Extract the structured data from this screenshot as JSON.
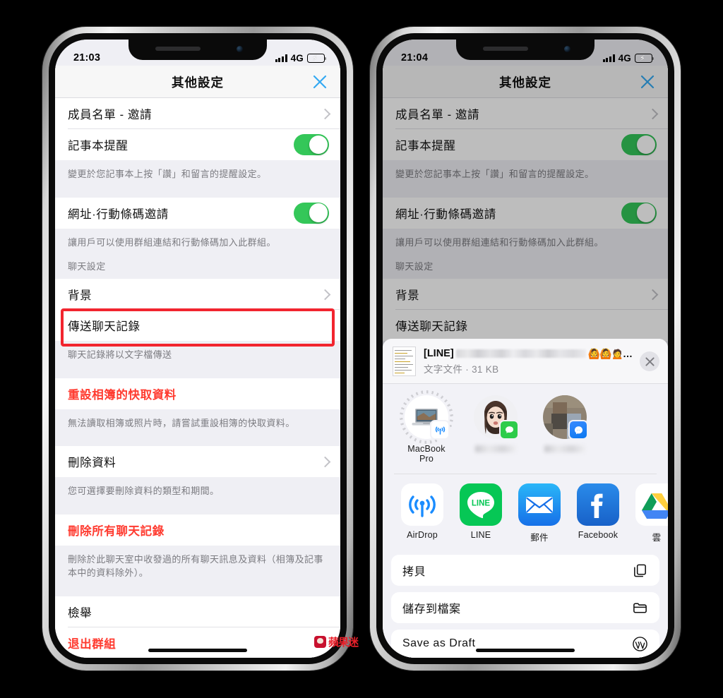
{
  "phones": {
    "left": {
      "status": {
        "time": "21:03",
        "network": "4G",
        "signal_bars": 4,
        "battery_charging": true
      },
      "nav": {
        "title": "其他設定",
        "close_icon": "close-x-icon"
      },
      "rows": [
        {
          "type": "link",
          "label": "成員名單 - 邀請"
        },
        {
          "type": "toggle",
          "label": "記事本提醒",
          "on": true
        },
        {
          "type": "note",
          "label": "變更於您記事本上按「讚」和留言的提醒設定。"
        },
        {
          "type": "toggle",
          "label": "網址·行動條碼邀請",
          "on": true
        },
        {
          "type": "note",
          "label": "讓用戶可以使用群組連結和行動條碼加入此群組。"
        },
        {
          "type": "head",
          "label": "聊天設定"
        },
        {
          "type": "link",
          "label": "背景"
        },
        {
          "type": "plain",
          "label": "傳送聊天記錄",
          "highlighted": true
        },
        {
          "type": "note",
          "label": "聊天記錄將以文字檔傳送"
        },
        {
          "type": "danger",
          "label": "重設相簿的快取資料"
        },
        {
          "type": "note",
          "label": "無法讀取相簿或照片時，請嘗試重設相簿的快取資料。"
        },
        {
          "type": "link",
          "label": "刪除資料"
        },
        {
          "type": "note",
          "label": "您可選擇要刪除資料的類型和期間。"
        },
        {
          "type": "danger",
          "label": "刪除所有聊天記錄"
        },
        {
          "type": "note",
          "label": "刪除於此聊天室中收發過的所有聊天訊息及資料（相簿及記事本中的資料除外）。"
        },
        {
          "type": "plain",
          "label": "檢舉"
        },
        {
          "type": "danger",
          "label": "退出群組"
        }
      ]
    },
    "right": {
      "status": {
        "time": "21:04",
        "network": "4G",
        "signal_bars": 4,
        "battery_charging": true
      },
      "nav": {
        "title": "其他設定",
        "close_icon": "close-x-icon"
      },
      "rows": [
        {
          "type": "link",
          "label": "成員名單 - 邀請"
        },
        {
          "type": "toggle",
          "label": "記事本提醒",
          "on": true
        },
        {
          "type": "note",
          "label": "變更於您記事本上按「讚」和留言的提醒設定。"
        },
        {
          "type": "toggle",
          "label": "網址·行動條碼邀請",
          "on": true
        },
        {
          "type": "note",
          "label": "讓用戶可以使用群組連結和行動條碼加入此群組。"
        },
        {
          "type": "head",
          "label": "聊天設定"
        },
        {
          "type": "link",
          "label": "背景"
        },
        {
          "type": "plain",
          "label": "傳送聊天記錄"
        }
      ]
    }
  },
  "share_sheet": {
    "file": {
      "name_prefix": "[LINE]",
      "name_redacted": true,
      "emoji": "🙆🙆🙍…",
      "meta": "文字文件 · 31 KB",
      "thumbnail_icon": "text-document-thumbnail",
      "close_icon": "close-circle-icon"
    },
    "contacts": [
      {
        "name": "MacBook Pro",
        "badge": "airdrop-icon",
        "avatar": "macbook-device-icon",
        "name_redacted": false
      },
      {
        "name": "",
        "badge": "messages-icon",
        "avatar": "memoji-avatar",
        "name_redacted": true
      },
      {
        "name": "",
        "badge": "messenger-icon",
        "avatar": "photo-avatar",
        "name_redacted": true
      }
    ],
    "apps": [
      {
        "label": "AirDrop",
        "icon": "airdrop-icon"
      },
      {
        "label": "LINE",
        "icon": "line-icon"
      },
      {
        "label": "郵件",
        "icon": "mail-icon"
      },
      {
        "label": "Facebook",
        "icon": "facebook-icon"
      },
      {
        "label": "雲",
        "icon": "google-drive-icon"
      }
    ],
    "actions": [
      {
        "label": "拷貝",
        "icon": "copy-icon",
        "highlighted": false
      },
      {
        "label": "儲存到檔案",
        "icon": "folder-icon",
        "highlighted": true
      },
      {
        "label": "Save as Draft",
        "icon": "wordpress-icon",
        "highlighted": false
      }
    ]
  },
  "watermark": {
    "text": "蘋果迷"
  },
  "colors": {
    "accent_blue": "#34a9f2",
    "toggle_green": "#34c759",
    "danger_red": "#ff3b30",
    "highlight_red": "#f2252f",
    "page_bg": "#efeff4",
    "sheet_bg": "#f2f2f7"
  }
}
